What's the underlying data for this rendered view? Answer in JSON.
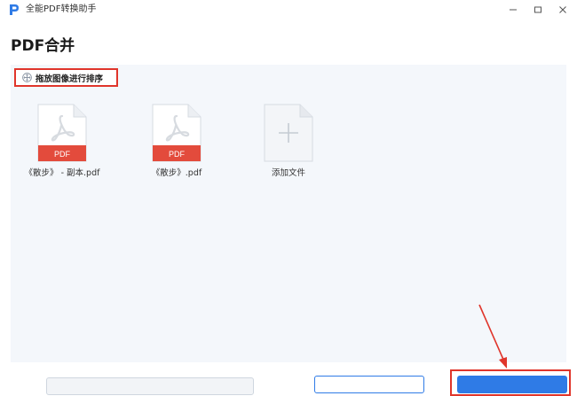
{
  "titlebar": {
    "app_title": "全能PDF转换助手",
    "minimize_icon": "minimize-icon",
    "maximize_icon": "maximize-icon",
    "close_icon": "close-icon"
  },
  "page": {
    "title": "PDF合并"
  },
  "sort_hint": {
    "label": "拖放图像进行排序",
    "icon": "move-icon"
  },
  "files": [
    {
      "name": "《散步》 - 副本.pdf",
      "badge": "PDF"
    },
    {
      "name": "《散步》.pdf",
      "badge": "PDF"
    }
  ],
  "add_file": {
    "label": "添加文件",
    "icon": "plus-icon"
  },
  "colors": {
    "accent": "#2f7be6",
    "highlight": "#e0352b",
    "pdf_badge": "#e34b3c",
    "panel_bg": "#f4f7fb"
  }
}
